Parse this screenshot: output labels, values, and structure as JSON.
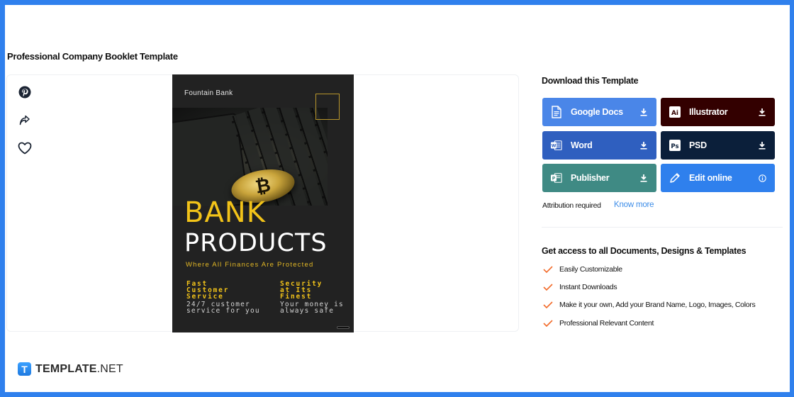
{
  "page": {
    "title": "Professional Company Booklet Template"
  },
  "actions": {
    "pinterest_icon": "pinterest-icon",
    "share_icon": "share-icon",
    "favorite_icon": "heart-icon"
  },
  "cover": {
    "bank_name": "Fountain Bank",
    "title_line_1": "BANK",
    "title_line_2": "PRODUCTS",
    "tagline": "Where All Finances Are Protected",
    "features": [
      {
        "title": [
          "Fast",
          "Customer",
          "Service"
        ],
        "desc": [
          "24/7 customer",
          "service for you"
        ]
      },
      {
        "title": [
          "Security",
          "at Its",
          "Finest"
        ],
        "desc": [
          "Your money is",
          "always safe"
        ]
      }
    ],
    "coin_symbol": "₿"
  },
  "download": {
    "heading": "Download this Template",
    "buttons": [
      {
        "label": "Google Docs",
        "icon": "google-docs-icon",
        "action_icon": "download-icon",
        "color": "#4a86e8"
      },
      {
        "label": "Illustrator",
        "icon": "illustrator-icon",
        "action_icon": "download-icon",
        "color": "#330000"
      },
      {
        "label": "Word",
        "icon": "word-icon",
        "action_icon": "download-icon",
        "color": "#2f5fbf"
      },
      {
        "label": "PSD",
        "icon": "photoshop-icon",
        "action_icon": "download-icon",
        "color": "#0b1f3a"
      },
      {
        "label": "Publisher",
        "icon": "publisher-icon",
        "action_icon": "download-icon",
        "color": "#3f8a84"
      },
      {
        "label": "Edit online",
        "icon": "pencil-icon",
        "action_icon": "info-icon",
        "color": "#2f80ed"
      }
    ],
    "attribution_text": "Attribution required",
    "attribution_link": "Know more"
  },
  "access": {
    "heading": "Get access to all Documents, Designs & Templates",
    "features": [
      "Easily Customizable",
      "Instant Downloads",
      "Make it your own, Add your Brand Name, Logo, Images, Colors",
      "Professional Relevant Content"
    ],
    "check_color": "#f26b2a"
  },
  "brand": {
    "mark": "T",
    "name_bold": "TEMPLATE",
    "name_light": ".NET"
  },
  "colors": {
    "frame": "#2f80ed",
    "gold": "#f2c319",
    "cover_bg": "#222222"
  }
}
